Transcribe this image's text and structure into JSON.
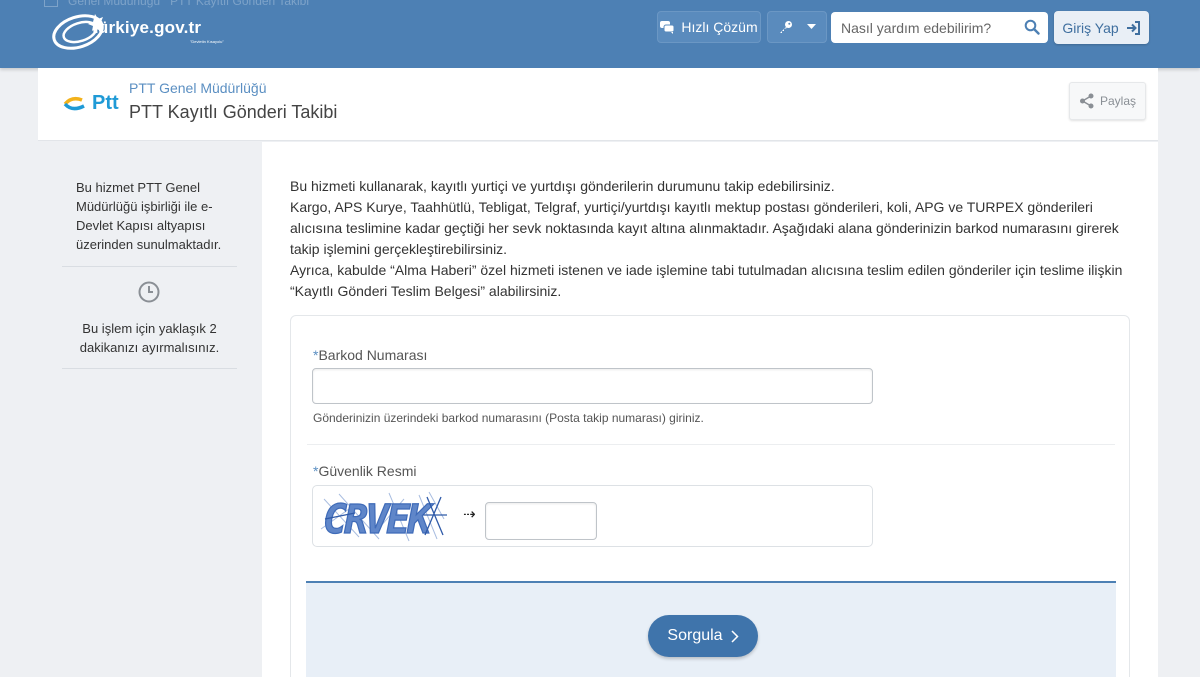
{
  "header": {
    "breadcrumb": [
      "Genel Müdürlüğü",
      "PTT Kayıtlı Gönderi Takibi"
    ],
    "logo_text": "türkiye.gov.tr",
    "logo_subtext": "\"Devletin Kısayolu\"",
    "quick_solution_label": "Hızlı Çözüm",
    "search_placeholder": "Nasıl yardım edebilirim?",
    "login_label": "Giriş Yap"
  },
  "page": {
    "organization": "PTT Genel Müdürlüğü",
    "title": "PTT Kayıtlı Gönderi Takibi",
    "logo_text": "Ptt",
    "share_label": "Paylaş"
  },
  "sidebar": {
    "info": "Bu hizmet PTT Genel Müdürlüğü işbirliği ile e-Devlet Kapısı altyapısı üzerinden sunulmaktadır.",
    "time_note": "Bu işlem için yaklaşık 2 dakikanızı ayırmalısınız."
  },
  "main": {
    "intro_lines": [
      "Bu hizmeti kullanarak, kayıtlı yurtiçi ve yurtdışı gönderilerin durumunu takip edebilirsiniz.",
      "Kargo, APS Kurye, Taahhütlü, Tebligat, Telgraf, yurtiçi/yurtdışı kayıtlı mektup postası gönderileri, koli, APG ve TURPEX gönderileri alıcısına teslimine kadar geçtiği her sevk noktasında kayıt altına alınmaktadır. Aşağıdaki alana gönderinizin barkod numarasını girerek takip işlemini gerçekleştirebilirsiniz.",
      "Ayrıca, kabulde “Alma Haberi” özel hizmeti istenen ve iade işlemine tabi tutulmadan alıcısına teslim edilen gönderiler için teslime ilişkin “Kayıtlı Gönderi Teslim Belgesi” alabilirsiniz."
    ],
    "form": {
      "required_mark": "*",
      "barcode_label": "Barkod Numarası",
      "barcode_value": "",
      "barcode_hint": "Gönderinizin üzerindeki barkod numarasını (Posta takip numarası) giriniz.",
      "captcha_label": "Güvenlik Resmi",
      "captcha_text": "CRVEK",
      "captcha_value": "",
      "submit_label": "Sorgula"
    }
  },
  "colors": {
    "header_blue": "#4d80b4",
    "link_blue": "#5b8fc2",
    "button_blue": "#3f74ab",
    "captcha_blue": "#5f86c9"
  }
}
